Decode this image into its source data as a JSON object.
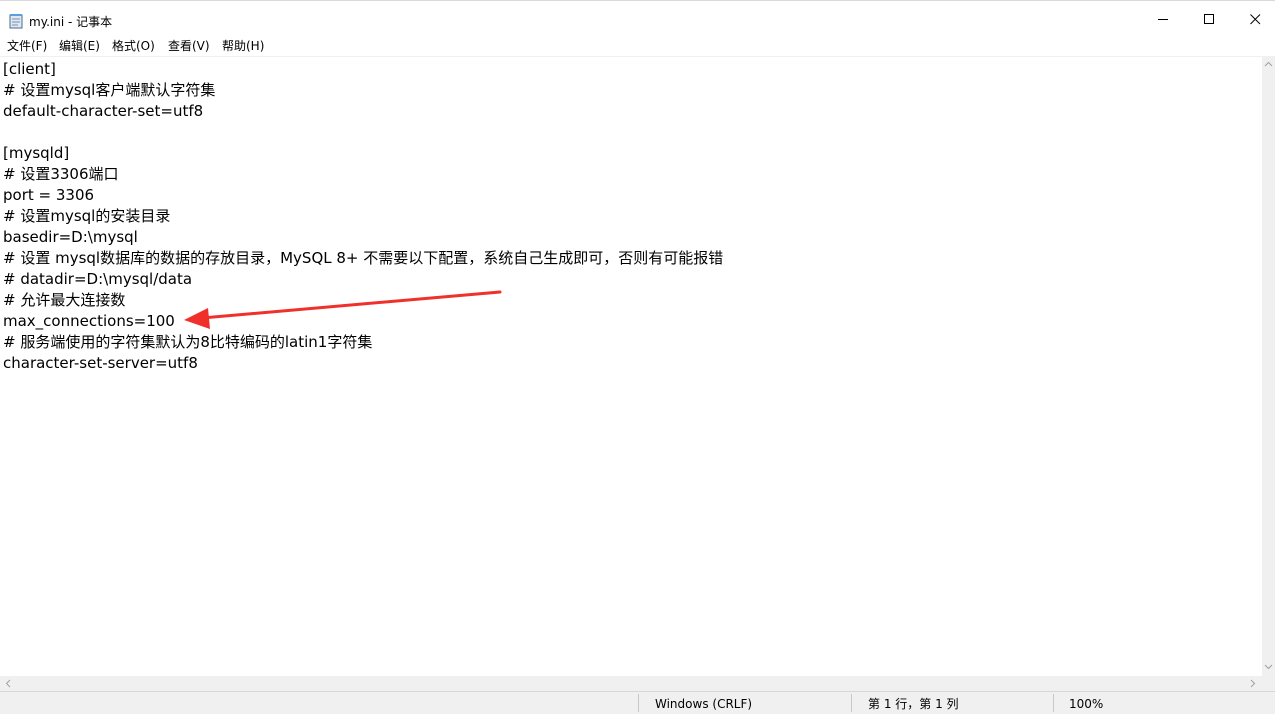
{
  "window": {
    "title": "my.ini - 记事本",
    "icon": "notepad-icon",
    "controls": [
      "minimize-icon",
      "maximize-icon",
      "close-icon"
    ]
  },
  "menu": {
    "items": [
      {
        "label": "文件(F)"
      },
      {
        "label": "编辑(E)"
      },
      {
        "label": "格式(O)"
      },
      {
        "label": "查看(V)"
      },
      {
        "label": "帮助(H)"
      }
    ]
  },
  "editor": {
    "lines": [
      "[client]",
      "# 设置mysql客户端默认字符集",
      "default-character-set=utf8",
      "",
      "[mysqld]",
      "# 设置3306端口",
      "port = 3306",
      "# 设置mysql的安装目录",
      "basedir=D:\\mysql",
      "# 设置 mysql数据库的数据的存放目录，MySQL 8+ 不需要以下配置，系统自己生成即可，否则有可能报错",
      "# datadir=D:\\mysql/data",
      "# 允许最大连接数",
      "max_connections=100",
      "# 服务端使用的字符集默认为8比特编码的latin1字符集",
      "character-set-server=utf8"
    ]
  },
  "annotation": {
    "arrow_color": "#f0302a"
  },
  "statusbar": {
    "encoding": "Windows (CRLF)",
    "position": "第 1 行，第 1 列",
    "zoom": "100%"
  }
}
